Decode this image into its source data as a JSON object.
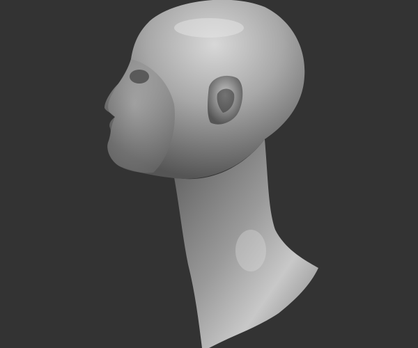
{
  "scene": {
    "background": "#333333",
    "material_light": "#d4d4d4",
    "material_mid": "#9a9a9a",
    "material_dark": "#4a4a4a"
  }
}
